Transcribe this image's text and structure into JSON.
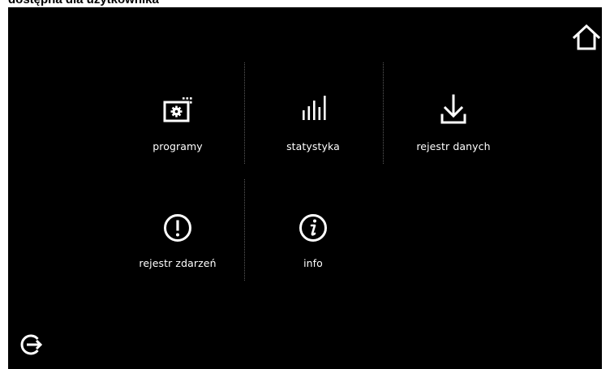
{
  "caption": "dostępna dla użytkownika",
  "nav": {
    "home_icon": "home-icon",
    "logout_icon": "logout-icon"
  },
  "menu": {
    "items": [
      {
        "label": "programy",
        "icon": "program-settings-icon"
      },
      {
        "label": "statystyka",
        "icon": "statistics-bars-icon"
      },
      {
        "label": "rejestr danych",
        "icon": "download-icon"
      },
      {
        "label": "rejestr zdarzeń",
        "icon": "exclamation-circle-icon"
      },
      {
        "label": "info",
        "icon": "info-circle-icon"
      }
    ]
  },
  "colors": {
    "background": "#000000",
    "foreground": "#ffffff",
    "divider": "#5a5a5a"
  }
}
